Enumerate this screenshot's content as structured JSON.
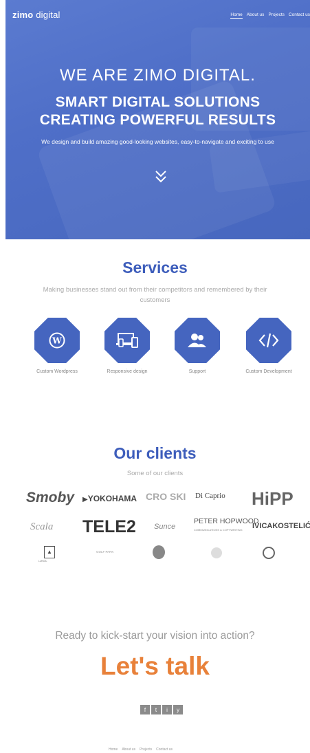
{
  "header": {
    "logo_bold": "zimo",
    "logo_light": "digital",
    "nav": [
      "Home",
      "About us",
      "Projects",
      "Contact us"
    ]
  },
  "hero": {
    "line1": "WE ARE ZIMO DIGITAL.",
    "line2": "SMART DIGITAL SOLUTIONS",
    "line3": "CREATING POWERFUL RESULTS",
    "subtitle": "We design and build amazing good-looking websites, easy-to-navigate and exciting to use",
    "scroll_icon": "double-chevron-down-icon"
  },
  "services": {
    "title": "Services",
    "subtitle": "Making businesses stand out from their competitors and remembered by their customers",
    "items": [
      {
        "label": "Custom Wordpress",
        "icon": "wordpress-icon"
      },
      {
        "label": "Responsive design",
        "icon": "devices-icon"
      },
      {
        "label": "Support",
        "icon": "users-icon"
      },
      {
        "label": "Custom Development",
        "icon": "code-icon"
      }
    ]
  },
  "clients": {
    "title": "Our clients",
    "subtitle": "Some of our clients",
    "logos": [
      "Smoby",
      "YOKOHAMA",
      "CRO SKI",
      "Di Caprio",
      "HiPP",
      "Scala",
      "TELE2",
      "Sunce",
      "PETER HOPWOOD",
      "COMMUNICATIONS & COPYWRITING",
      "IVICAKOSTELIĆ",
      "LUKOIL",
      "GOLF PARK",
      "",
      "",
      ""
    ]
  },
  "cta": {
    "question": "Ready to kick-start your vision into action?",
    "headline": "Let's talk",
    "social": [
      "f",
      "t",
      "i",
      "y"
    ]
  },
  "footer": {
    "nav": [
      "Home",
      "About us",
      "Projects",
      "Contact us"
    ]
  },
  "colors": {
    "brand_blue": "#4565bf",
    "accent_orange": "#e8813a"
  }
}
